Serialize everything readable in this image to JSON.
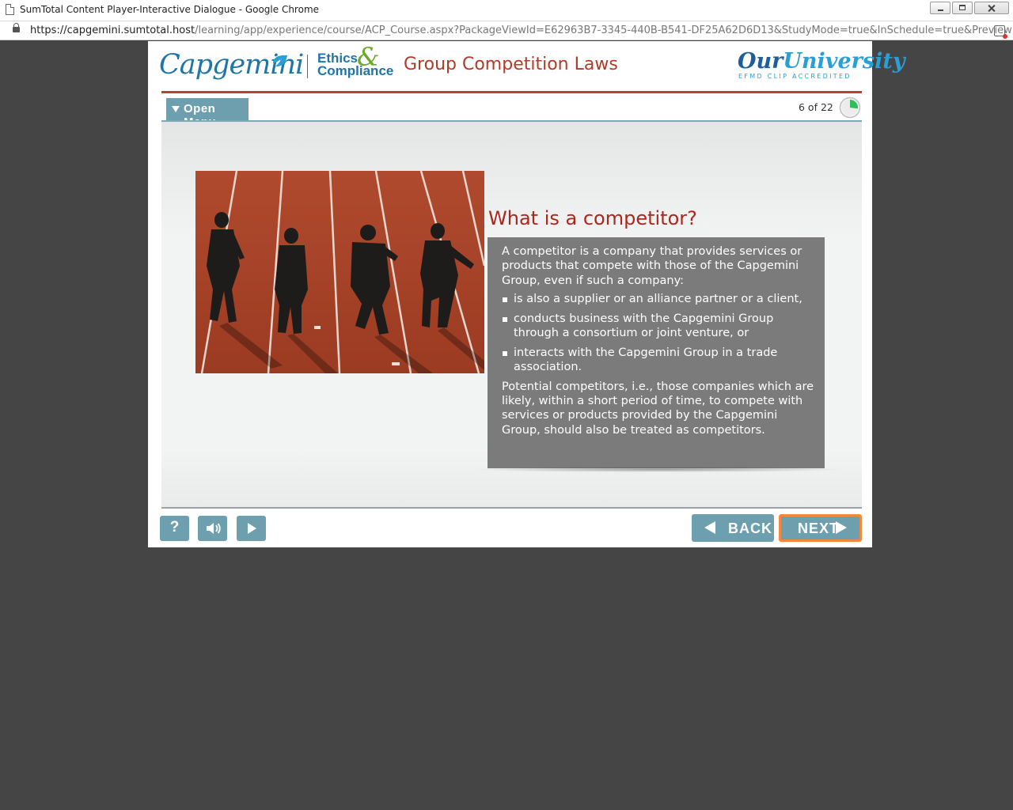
{
  "window": {
    "title": "SumTotal Content Player-Interactive Dialogue - Google Chrome"
  },
  "address": {
    "host": "https://capgemini.sumtotal.host",
    "path": "/learning/app/experience/course/ACP_Course.aspx?PackageViewId=E62963B7-3345-440B-B541-DF25A62D6D13&StudyMode=true&InSchedule=true&Preview=..."
  },
  "header": {
    "brand": "Capgemini",
    "ethics_line1": "Ethics",
    "ethics_amp": "&",
    "ethics_line2": "Compliance",
    "course_title": "Group Competition Laws",
    "our": "Our",
    "university": "University",
    "accreditation": "EFMD CLIP ACCREDITED"
  },
  "toolbar": {
    "menu_label": "Open Menu",
    "counter": "6 of 22",
    "progress_fraction": 0.2727
  },
  "slide": {
    "heading": "What is a competitor?",
    "intro": "A competitor is a company that provides services or products that compete with those of the Capgemini Group, even if such a company:",
    "bullets": [
      "is also a supplier or an alliance partner or a client,",
      "conducts business with the Capgemini Group through a consortium or joint venture, or",
      "interacts with the Capgemini Group in a trade association."
    ],
    "closing": "Potential competitors, i.e., those companies which are likely, within a short period of time, to compete with services or products provided by the Capgemini Group, should also be treated as competitors."
  },
  "controls": {
    "help_label": "?",
    "back_label": "BACK",
    "next_label": "NEXT"
  },
  "colors": {
    "teal": "#6e9fae",
    "heading_red": "#a9281f",
    "brand_blue": "#1f75a8",
    "next_outline": "#f08a3c",
    "progress_green": "#2fbf5a"
  }
}
